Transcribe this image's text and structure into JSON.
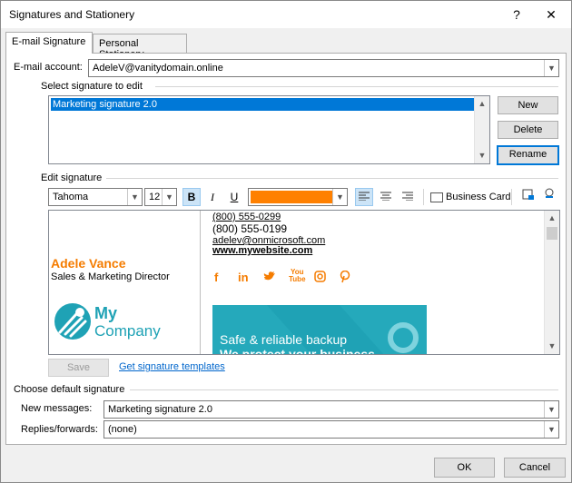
{
  "window": {
    "title": "Signatures and Stationery",
    "help_glyph": "?",
    "close_glyph": "✕"
  },
  "tabs": [
    {
      "label": "E-mail Signature"
    },
    {
      "label": "Personal Stationery"
    }
  ],
  "email_account": {
    "label": "E-mail account:",
    "value": "AdeleV@vanitydomain.online"
  },
  "select_signature": {
    "label": "Select signature to edit",
    "items": [
      "Marketing signature 2.0"
    ]
  },
  "buttons": {
    "new": "New",
    "delete": "Delete",
    "rename": "Rename",
    "save": "Save",
    "ok": "OK",
    "cancel": "Cancel"
  },
  "edit_signature": {
    "label": "Edit signature",
    "font": "Tahoma",
    "size": "12",
    "bold": "B",
    "italic": "I",
    "underline": "U",
    "font_color": "#ff8000",
    "business_card": "Business Card"
  },
  "signature": {
    "name": "Adele Vance",
    "title": "Sales & Marketing Director",
    "logo_line1": "My",
    "logo_line2": "Company",
    "phone1": "(800) 555-0299",
    "phone2": "(800) 555-0199",
    "email": "adelev@onmicrosoft.com",
    "website": "www.mywebsite.com",
    "social": [
      "f",
      "in",
      "twitter",
      "YouTube",
      "instagram",
      "pinterest"
    ],
    "banner_line1": "Safe & reliable backup",
    "banner_line2": "We protect your business",
    "accent": "#f57c00",
    "brand": "#1fa2b5"
  },
  "templates_link": "Get signature templates",
  "defaults": {
    "label": "Choose default signature",
    "new_messages_label": "New messages:",
    "new_messages_value": "Marketing signature 2.0",
    "replies_label": "Replies/forwards:",
    "replies_value": "(none)"
  }
}
